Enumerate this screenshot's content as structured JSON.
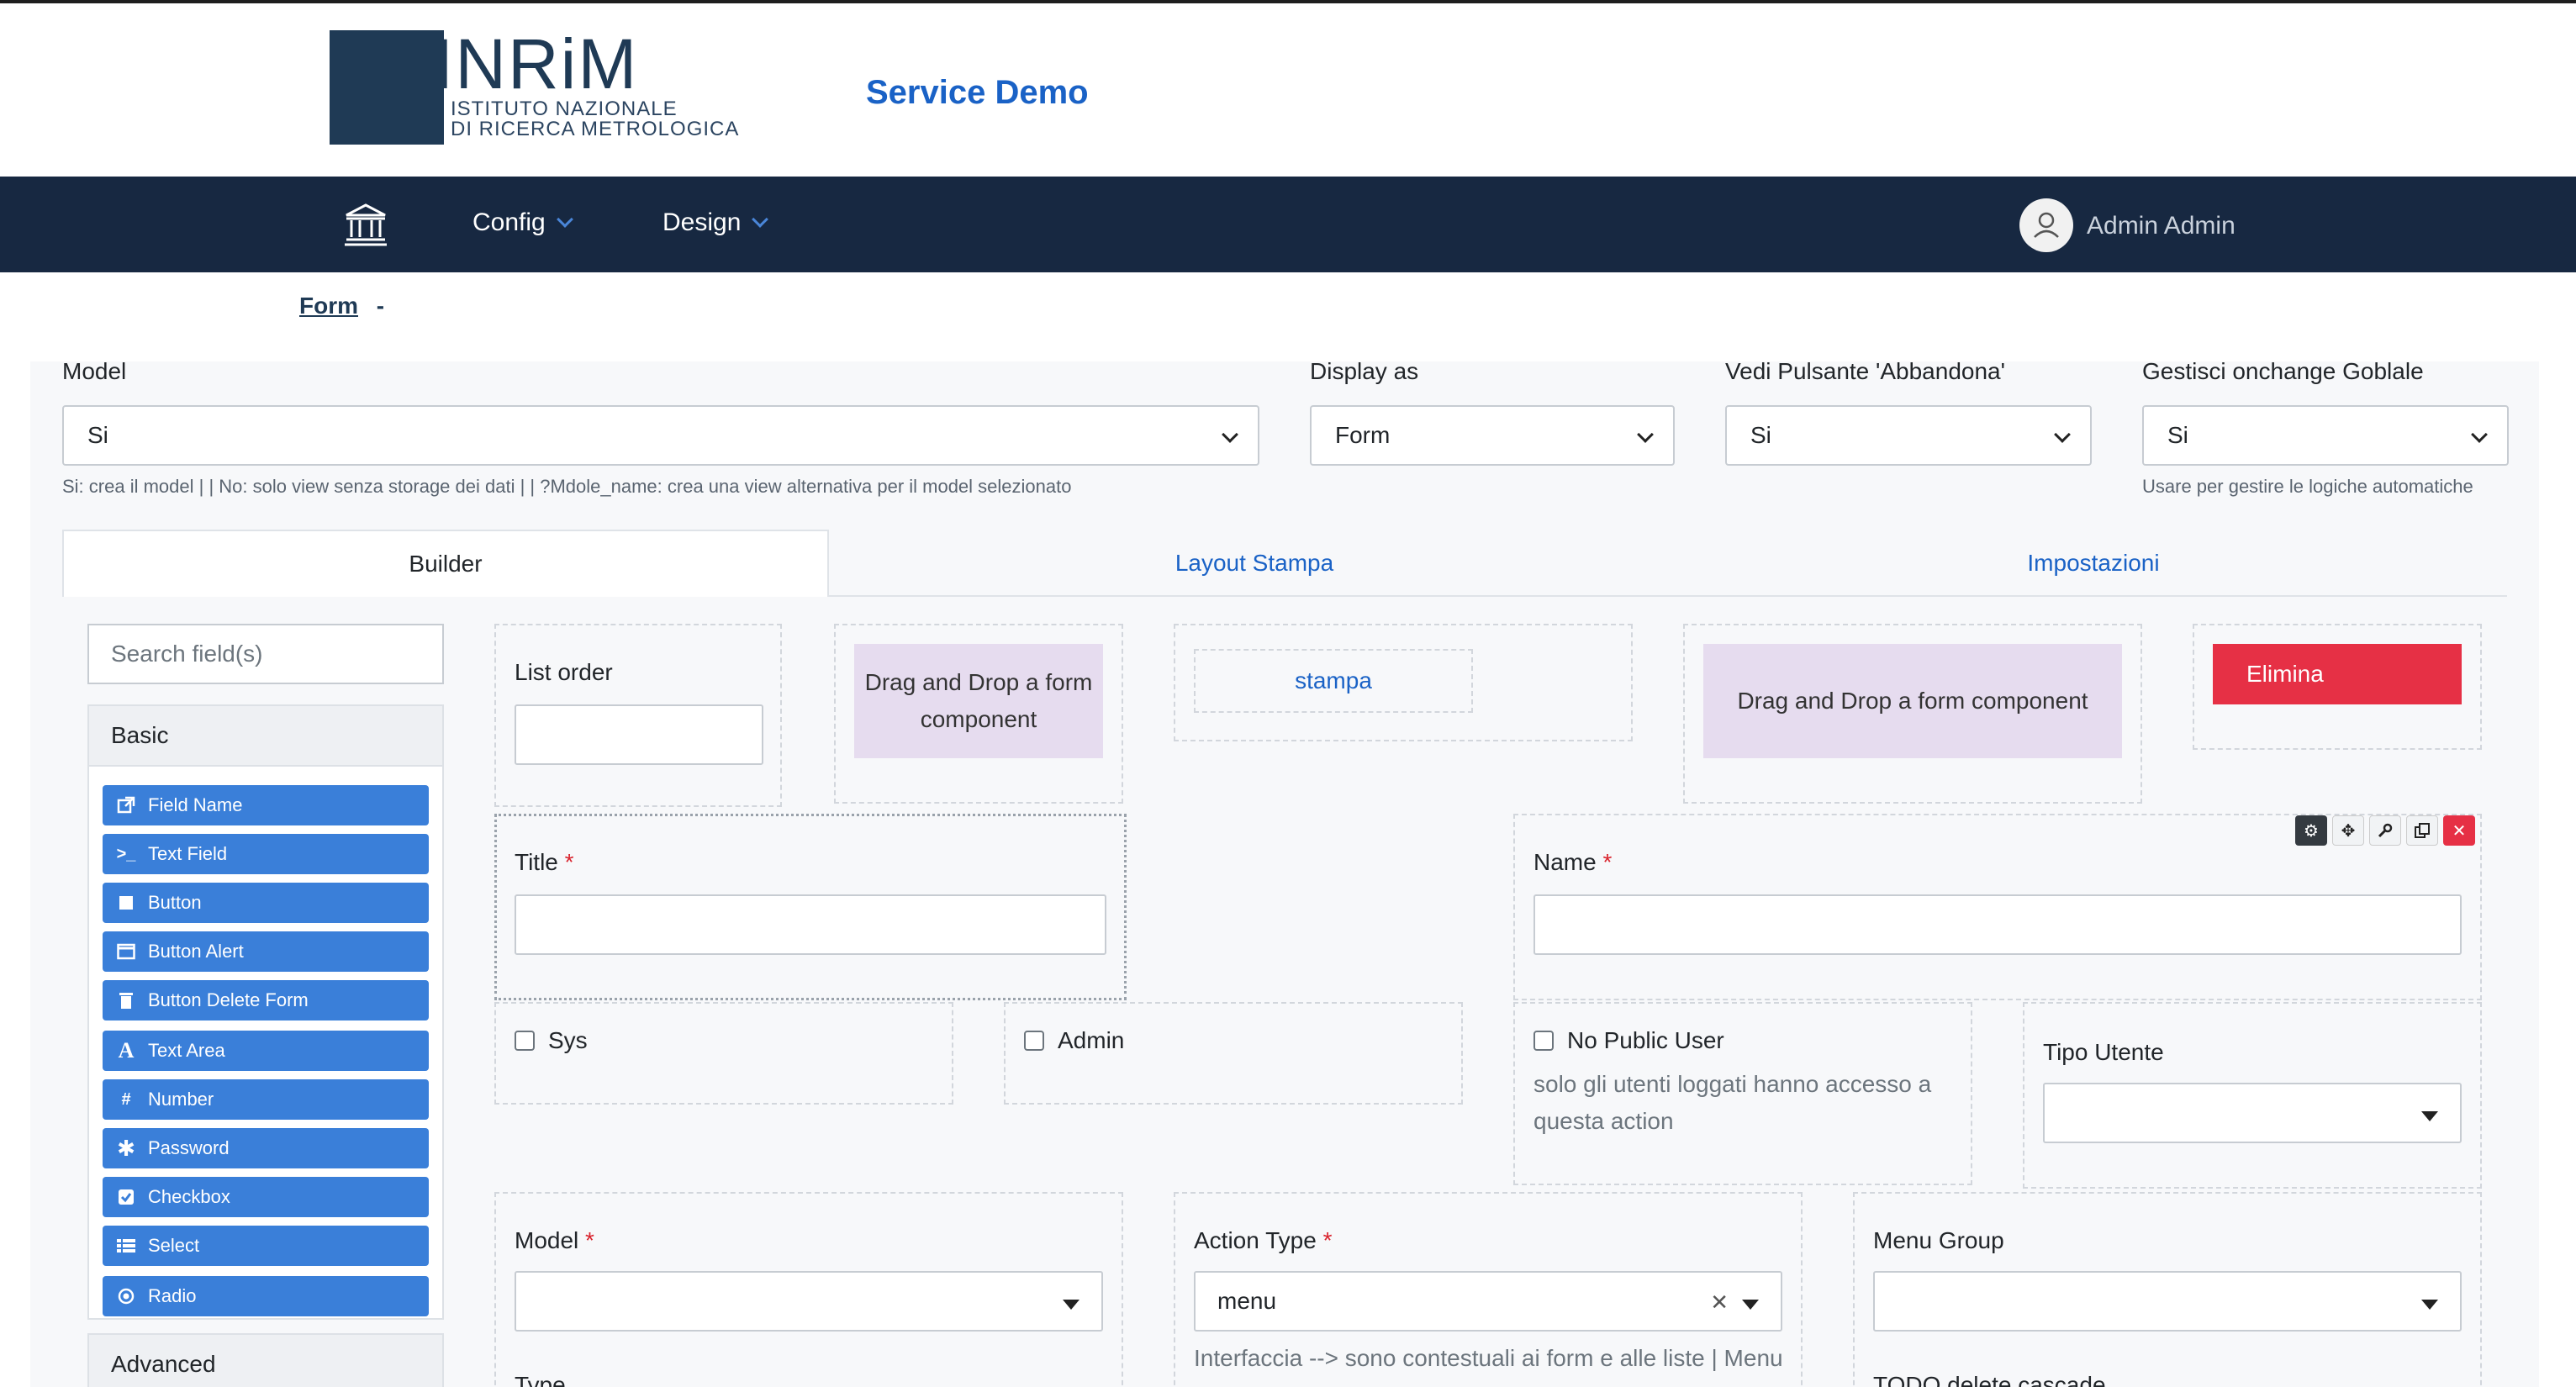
{
  "header": {
    "logo_text": "INRiM",
    "logo_sub_1": "ISTITUTO NAZIONALE",
    "logo_sub_2": "DI RICERCA METROLOGICA",
    "service_title": "Service Demo"
  },
  "navbar": {
    "config_label": "Config",
    "design_label": "Design",
    "user_name": "Admin Admin"
  },
  "breadcrumb": {
    "link": "Form",
    "separator": "-"
  },
  "settings": {
    "model_label": "Model",
    "model_value": "Si",
    "model_help": "Si: crea il model | | No: solo view senza storage dei dati | | ?Mdole_name: crea una view alternativa per il model selezionato",
    "display_label": "Display as",
    "display_value": "Form",
    "abbandona_label": "Vedi Pulsante 'Abbandona'",
    "abbandona_value": "Si",
    "onchange_label": "Gestisci onchange Goblale",
    "onchange_value": "Si",
    "onchange_help": "Usare per gestire le logiche automatiche"
  },
  "tabs": {
    "builder": "Builder",
    "layout": "Layout Stampa",
    "impostazioni": "Impostazioni"
  },
  "sidebar": {
    "search_placeholder": "Search field(s)",
    "basic_label": "Basic",
    "advanced_label": "Advanced",
    "components": [
      {
        "label": "Field Name",
        "icon": "external-link-icon"
      },
      {
        "label": "Text Field",
        "icon": "terminal-icon"
      },
      {
        "label": "Button",
        "icon": "stop-square-icon"
      },
      {
        "label": "Button Alert",
        "icon": "window-icon"
      },
      {
        "label": "Button Delete Form",
        "icon": "trash-icon"
      },
      {
        "label": "Text Area",
        "icon": "font-icon"
      },
      {
        "label": "Number",
        "icon": "hashtag-icon"
      },
      {
        "label": "Password",
        "icon": "asterisk-icon"
      },
      {
        "label": "Checkbox",
        "icon": "check-square-icon"
      },
      {
        "label": "Select",
        "icon": "list-icon"
      },
      {
        "label": "Radio",
        "icon": "dot-circle-icon"
      }
    ]
  },
  "builder": {
    "list_order_label": "List order",
    "dropzone_1": "Drag and Drop a form component",
    "stampa_label": "stampa",
    "dropzone_2": "Drag and Drop a form component",
    "elimina_label": "Elimina",
    "title_label": "Title",
    "required_mark": "*",
    "name_label": "Name",
    "sys_label": "Sys",
    "admin_label": "Admin",
    "no_public_label": "No Public User",
    "no_public_help": "solo gli utenti loggati hanno accesso a questa action",
    "tipo_utente_label": "Tipo Utente",
    "model_label": "Model",
    "action_type_label": "Action Type",
    "action_type_value": "menu",
    "action_type_help": "Interfaccia --> sono contestuali ai form e alle liste | Menu",
    "menu_group_label": "Menu Group",
    "type_label": "Type",
    "todo_label": "TODO delete cascade"
  }
}
